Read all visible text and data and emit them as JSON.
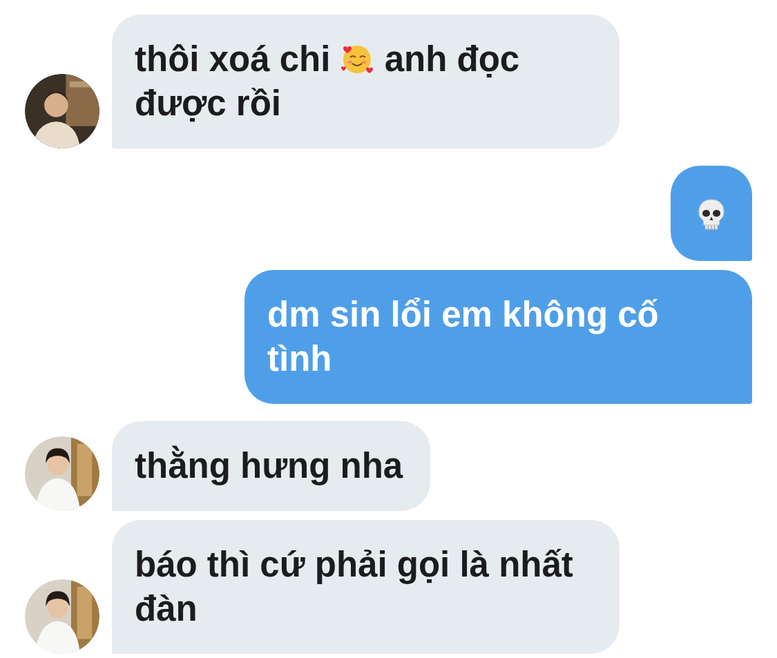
{
  "messages": [
    {
      "outgoing": false,
      "avatar": {
        "kind": "picture"
      },
      "parts": [
        {
          "kind": "text",
          "text": "thôi xoá chi"
        },
        {
          "kind": "heartface"
        },
        {
          "kind": "text",
          "text": "anh đọc"
        },
        {
          "kind": "text",
          "text": "được rồi"
        }
      ]
    },
    {
      "outgoing": true,
      "parts": [
        {
          "kind": "skull"
        }
      ]
    },
    {
      "outgoing": true,
      "parts": [
        {
          "kind": "text",
          "text": "dm sin lổi em không cố tình"
        }
      ]
    },
    {
      "outgoing": false,
      "avatar": {
        "kind": "picture"
      },
      "parts": [
        {
          "kind": "text",
          "text": "thằng hưng nha"
        }
      ]
    },
    {
      "outgoing": false,
      "avatar": {
        "kind": "picture"
      },
      "parts": [
        {
          "kind": "text",
          "text": "báo thì cứ phải gọi là nhất đàn"
        }
      ]
    }
  ]
}
